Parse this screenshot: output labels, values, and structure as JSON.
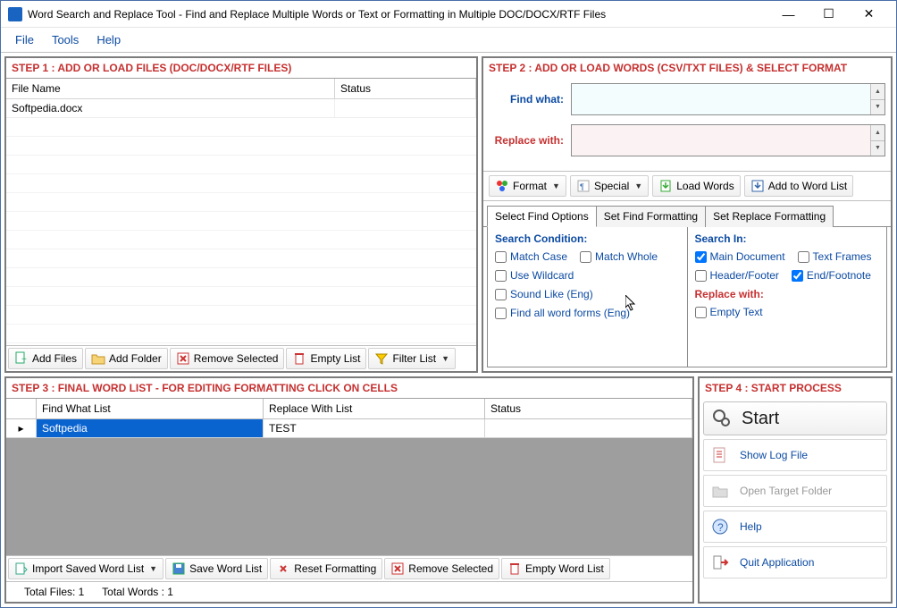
{
  "title": "Word Search and Replace Tool - Find and Replace Multiple Words or Text  or Formatting in Multiple DOC/DOCX/RTF Files",
  "menu": {
    "file": "File",
    "tools": "Tools",
    "help": "Help"
  },
  "step1": {
    "header": "STEP 1 : ADD OR LOAD FILES (DOC/DOCX/RTF FILES)",
    "col_file": "File Name",
    "col_status": "Status",
    "row1_file": "Softpedia.docx",
    "row1_status": "",
    "btn_add_files": "Add Files",
    "btn_add_folder": "Add Folder",
    "btn_remove": "Remove Selected",
    "btn_empty": "Empty List",
    "btn_filter": "Filter List"
  },
  "step2": {
    "header": "STEP 2 : ADD OR LOAD WORDS (CSV/TXT FILES) & SELECT FORMAT",
    "find_label": "Find what:",
    "replace_label": "Replace with:",
    "btn_format": "Format",
    "btn_special": "Special",
    "btn_load": "Load Words",
    "btn_add": "Add to Word List",
    "tab_find": "Select Find Options",
    "tab_findfmt": "Set Find Formatting",
    "tab_replfmt": "Set Replace Formatting",
    "search_cond": "Search Condition:",
    "search_in": "Search In:",
    "chk_matchcase": "Match Case",
    "chk_matchwhole": "Match Whole",
    "chk_wildcard": "Use Wildcard",
    "chk_soundlike": "Sound Like (Eng)",
    "chk_wordforms": "Find all word forms (Eng)",
    "chk_maindoc": "Main Document",
    "chk_textframes": "Text Frames",
    "chk_header": "Header/Footer",
    "chk_endnote": "End/Footnote",
    "replace_with_hdr": "Replace with:",
    "chk_emptytext": "Empty Text"
  },
  "step3": {
    "header": "STEP 3 : FINAL WORD LIST - FOR EDITING FORMATTING CLICK ON CELLS",
    "col_find": "Find What List",
    "col_repl": "Replace With List",
    "col_status": "Status",
    "row1_find": "Softpedia",
    "row1_repl": "TEST",
    "row1_status": "",
    "btn_import": "Import Saved Word List",
    "btn_save": "Save Word List",
    "btn_reset": "Reset Formatting",
    "btn_remove": "Remove Selected",
    "btn_empty": "Empty Word List"
  },
  "step4": {
    "header": "STEP 4 : START PROCESS",
    "start": "Start",
    "log": "Show Log File",
    "target": "Open Target Folder",
    "help": "Help",
    "quit": "Quit Application"
  },
  "status": {
    "total_files": "Total Files: 1",
    "total_words": "Total Words : 1"
  }
}
